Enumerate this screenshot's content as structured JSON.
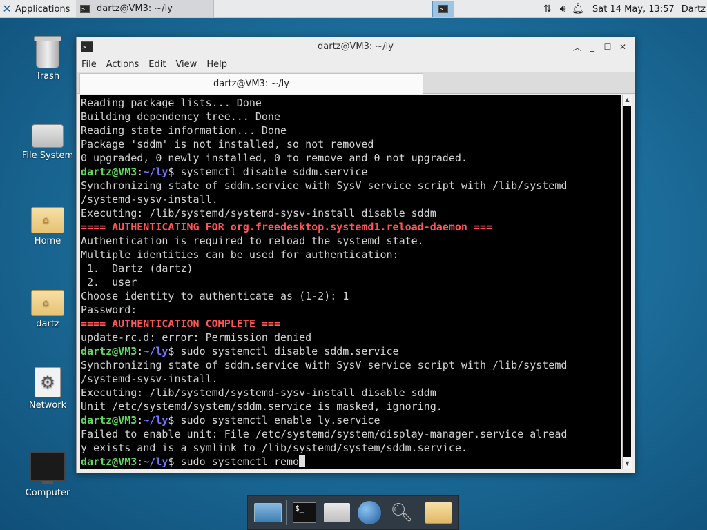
{
  "top_panel": {
    "applications_label": "Applications",
    "task_title": "dartz@VM3: ~/ly",
    "clock": "Sat 14 May, 13:57",
    "user": "Dartz",
    "tray_icons": [
      "network-icon",
      "volume-icon",
      "notification-bell-icon"
    ]
  },
  "desktop_icons": [
    {
      "label": "Trash",
      "icon": "trash-icon"
    },
    {
      "label": "File System",
      "icon": "drive-icon"
    },
    {
      "label": "Home",
      "icon": "home-folder-icon"
    },
    {
      "label": "dartz",
      "icon": "folder-icon"
    },
    {
      "label": "Network",
      "icon": "network-icon"
    },
    {
      "label": "Computer",
      "icon": "monitor-icon"
    }
  ],
  "window": {
    "title": "dartz@VM3: ~/ly",
    "menu": [
      "File",
      "Actions",
      "Edit",
      "View",
      "Help"
    ],
    "tab_label": "dartz@VM3: ~/ly"
  },
  "terminal": {
    "user_host": "dartz@VM3",
    "path": "~/ly",
    "lines": [
      {
        "type": "out",
        "text": "Reading package lists... Done"
      },
      {
        "type": "out",
        "text": "Building dependency tree... Done"
      },
      {
        "type": "out",
        "text": "Reading state information... Done"
      },
      {
        "type": "out",
        "text": "Package 'sddm' is not installed, so not removed"
      },
      {
        "type": "out",
        "text": "0 upgraded, 0 newly installed, 0 to remove and 0 not upgraded."
      },
      {
        "type": "prompt",
        "text": "systemctl disable sddm.service"
      },
      {
        "type": "out",
        "text": "Synchronizing state of sddm.service with SysV service script with /lib/systemd"
      },
      {
        "type": "out",
        "text": "/systemd-sysv-install."
      },
      {
        "type": "out",
        "text": "Executing: /lib/systemd/systemd-sysv-install disable sddm"
      },
      {
        "type": "red",
        "text": "==== AUTHENTICATING FOR org.freedesktop.systemd1.reload-daemon ==="
      },
      {
        "type": "out",
        "text": "Authentication is required to reload the systemd state."
      },
      {
        "type": "out",
        "text": "Multiple identities can be used for authentication:"
      },
      {
        "type": "out",
        "text": " 1.  Dartz (dartz)"
      },
      {
        "type": "out",
        "text": " 2.  user"
      },
      {
        "type": "out",
        "text": "Choose identity to authenticate as (1-2): 1"
      },
      {
        "type": "out",
        "text": "Password:"
      },
      {
        "type": "red",
        "text": "==== AUTHENTICATION COMPLETE ==="
      },
      {
        "type": "out",
        "text": "update-rc.d: error: Permission denied"
      },
      {
        "type": "prompt",
        "text": "sudo systemctl disable sddm.service"
      },
      {
        "type": "out",
        "text": "Synchronizing state of sddm.service with SysV service script with /lib/systemd"
      },
      {
        "type": "out",
        "text": "/systemd-sysv-install."
      },
      {
        "type": "out",
        "text": "Executing: /lib/systemd/systemd-sysv-install disable sddm"
      },
      {
        "type": "out",
        "text": "Unit /etc/systemd/system/sddm.service is masked, ignoring."
      },
      {
        "type": "prompt",
        "text": "sudo systemctl enable ly.service"
      },
      {
        "type": "out",
        "text": "Failed to enable unit: File /etc/systemd/system/display-manager.service alread"
      },
      {
        "type": "out",
        "text": "y exists and is a symlink to /lib/systemd/system/sddm.service."
      },
      {
        "type": "prompt",
        "text": "sudo systemctl remo",
        "cursor": true
      }
    ]
  },
  "dock": {
    "items": [
      "show-desktop-icon",
      "terminal-icon",
      "home-icon",
      "web-browser-icon",
      "search-icon",
      "folder-icon"
    ]
  }
}
